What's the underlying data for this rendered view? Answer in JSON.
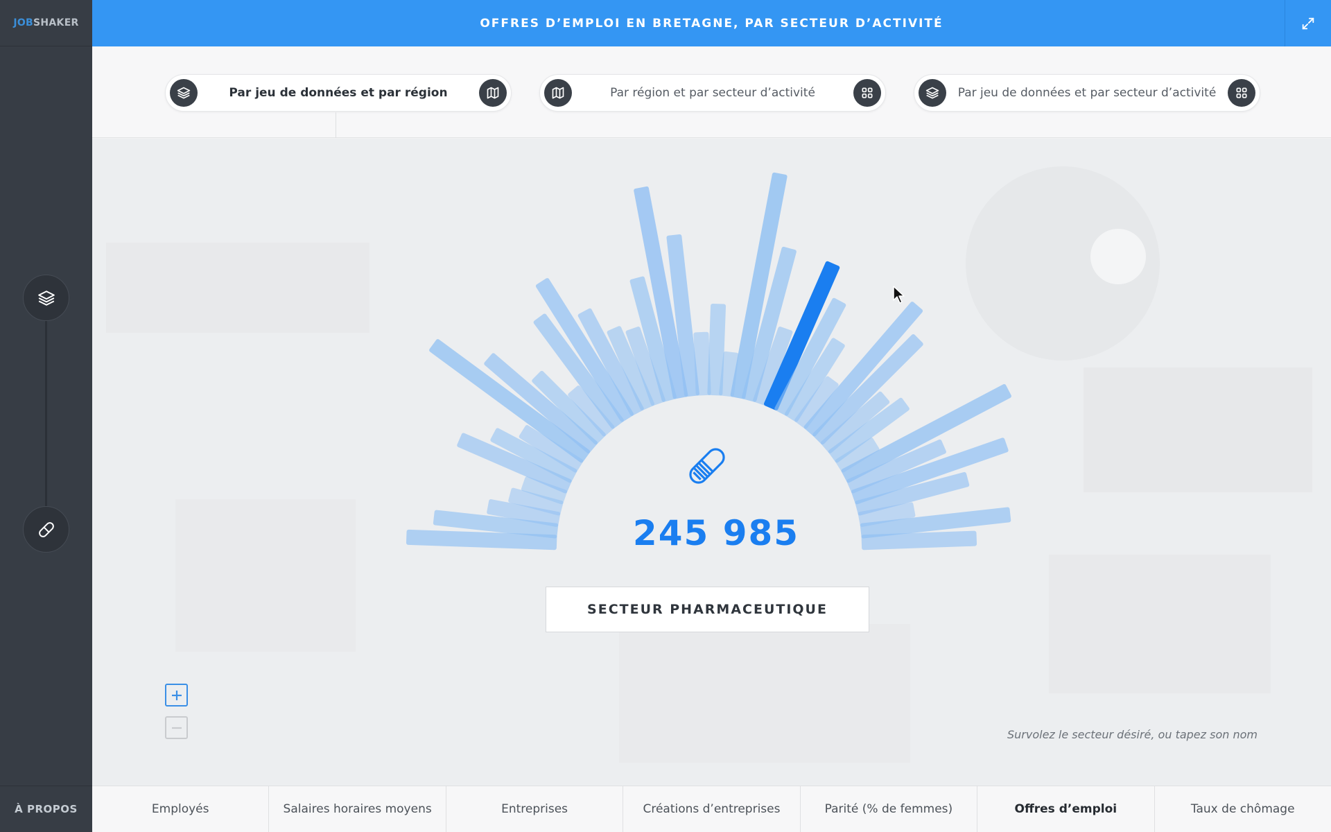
{
  "app": {
    "logo_part1": "JOB",
    "logo_part2": "SHAKER",
    "title": "OFFRES D’EMPLOI EN BRETAGNE, PAR SECTEUR D’ACTIVITÉ",
    "about_label": "À PROPOS"
  },
  "colors": {
    "topbar": "#3496f3",
    "sidebar": "#373d45",
    "accent": "#1a7ef0",
    "bar_highlight": "#1a7ef0",
    "bar_default": "#8fbff3"
  },
  "modes": [
    {
      "label": "Par jeu de données et par région",
      "left_icon": "layers-icon",
      "right_icon": "map-icon",
      "active": true
    },
    {
      "label": "Par région et par secteur d’activité",
      "left_icon": "map-icon",
      "right_icon": "grid-icon",
      "active": false
    },
    {
      "label": "Par jeu de données et par secteur d’activité",
      "left_icon": "layers-icon",
      "right_icon": "grid-icon",
      "active": false
    }
  ],
  "sidebar_icons": [
    "layers-icon",
    "pill-icon"
  ],
  "selection": {
    "value": "245 985",
    "sector": "SECTEUR PHARMACEUTIQUE",
    "icon": "pill-icon"
  },
  "hint": "Survolez le secteur désiré, ou tapez son nom",
  "zoom": {
    "in_icon": "plus-icon",
    "out_icon": "minus-icon"
  },
  "tabs": [
    "Employés",
    "Salaires horaires moyens",
    "Entreprises",
    "Créations d’entreprises",
    "Parité (% de femmes)",
    "Offres d’emploi",
    "Taux de chômage"
  ],
  "active_tab": "Offres d’emploi",
  "chart_data": {
    "type": "radial-bar",
    "relative_values": [
      0.55,
      0.44,
      0.22,
      0.14,
      0.1,
      0.42,
      0.3,
      0.2,
      0.72,
      0.5,
      0.3,
      0.15,
      0.48,
      0.6,
      0.4,
      0.28,
      0.25,
      0.45,
      0.82,
      0.6,
      0.18,
      0.3,
      0.1,
      0.88,
      0.58,
      0.25,
      0.58,
      0.45,
      0.3,
      0.15,
      0.62,
      0.52,
      0.25,
      0.3,
      0.1,
      0.7,
      0.35,
      0.6,
      0.4,
      0.15,
      0.55,
      0.4
    ],
    "highlight_index": 26
  }
}
